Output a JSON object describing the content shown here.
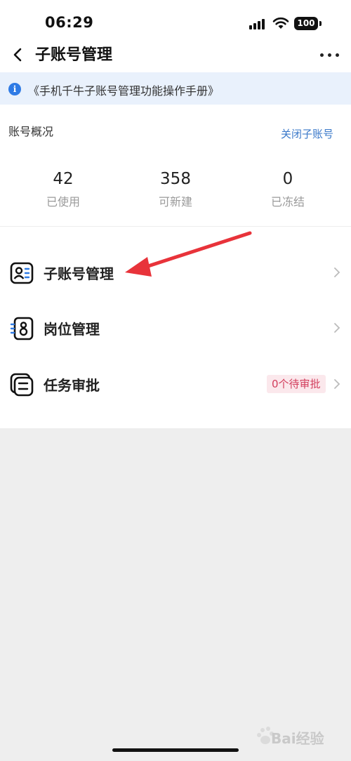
{
  "status_bar": {
    "time": "06:29",
    "battery": "100"
  },
  "nav": {
    "title": "子账号管理"
  },
  "banner": {
    "text": "《手机千牛子账号管理功能操作手册》"
  },
  "overview": {
    "title": "账号概况",
    "action": "关闭子账号",
    "stats": [
      {
        "value": "42",
        "label": "已使用"
      },
      {
        "value": "358",
        "label": "可新建"
      },
      {
        "value": "0",
        "label": "已冻结"
      }
    ]
  },
  "menu": [
    {
      "label": "子账号管理",
      "icon": "contact-card-icon"
    },
    {
      "label": "岗位管理",
      "icon": "position-badge-icon"
    },
    {
      "label": "任务审批",
      "icon": "approval-list-icon",
      "badge": "0个待审批"
    }
  ],
  "watermark": {
    "text": "Bai经验"
  },
  "colors": {
    "accent": "#3a78c9",
    "banner_bg": "#e9f1fc",
    "badge_text": "#d23d5c",
    "arrow": "#e8333a"
  }
}
